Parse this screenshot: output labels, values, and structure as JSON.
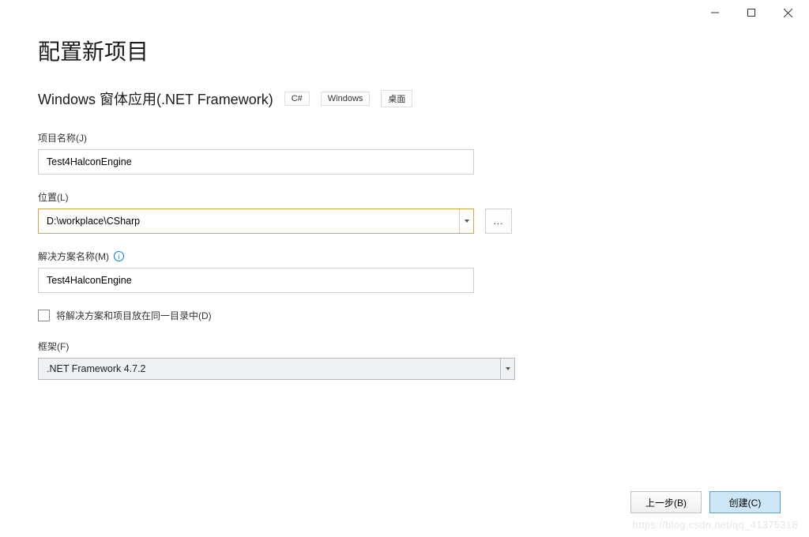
{
  "page": {
    "title": "配置新项目",
    "subtitle": "Windows 窗体应用(.NET Framework)",
    "tags": [
      "C#",
      "Windows",
      "桌面"
    ]
  },
  "fields": {
    "project_name": {
      "label": "项目名称(J)",
      "value": "Test4HalconEngine"
    },
    "location": {
      "label": "位置(L)",
      "value": "D:\\workplace\\CSharp",
      "browse_label": "..."
    },
    "solution_name": {
      "label": "解决方案名称(M)",
      "value": "Test4HalconEngine"
    },
    "same_dir": {
      "label": "将解决方案和项目放在同一目录中(D)",
      "checked": false
    },
    "framework": {
      "label": "框架(F)",
      "value": ".NET Framework 4.7.2"
    }
  },
  "footer": {
    "back": "上一步(B)",
    "create": "创建(C)"
  },
  "watermark": "https://blog.csdn.net/qq_41375318"
}
